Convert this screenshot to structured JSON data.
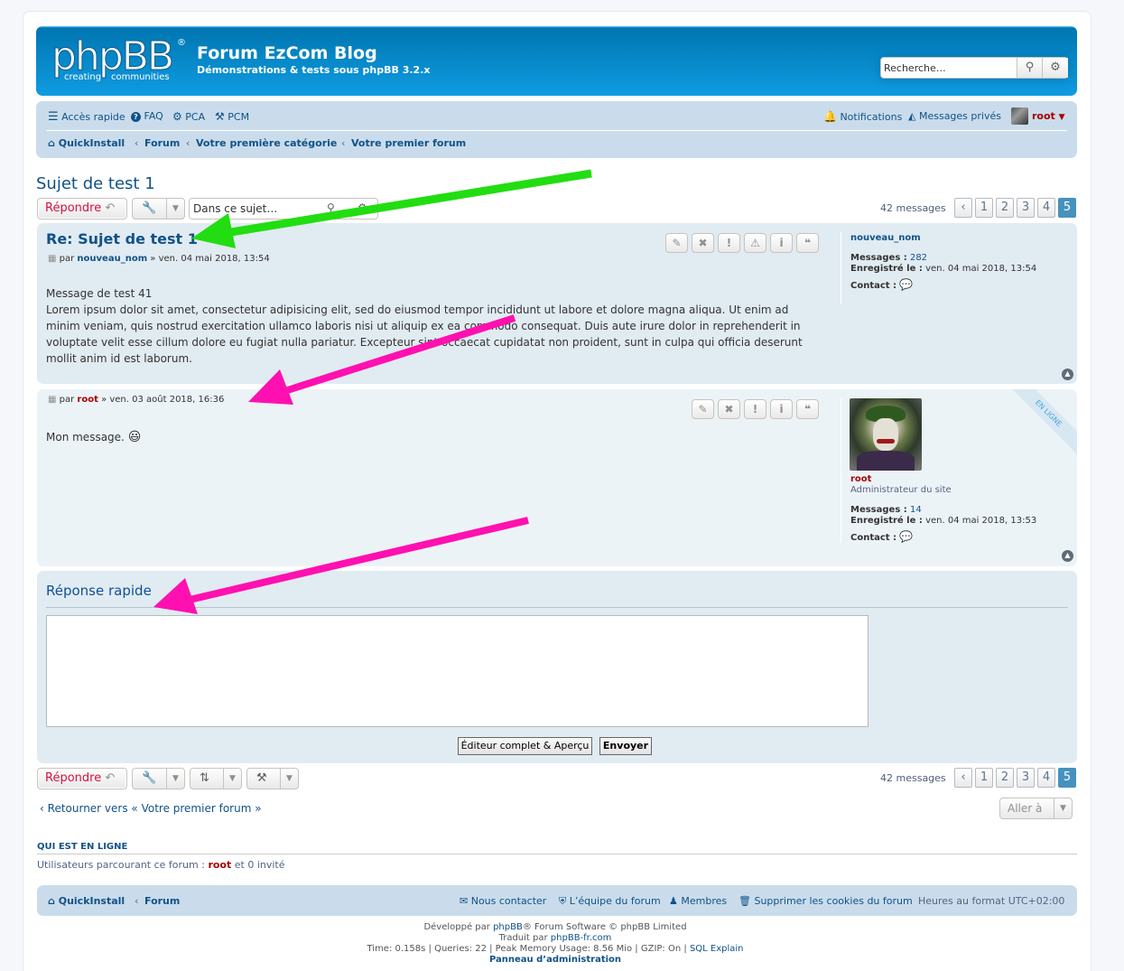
{
  "header": {
    "logo_text": "phpBB",
    "logo_reg": "®",
    "logo_tag1": "creating",
    "logo_tag2": "communities",
    "site_title": "Forum EzCom Blog",
    "site_description": "Démonstrations & tests sous phpBB 3.2.x",
    "search_placeholder": "Recherche…",
    "search_icon": "search-icon",
    "settings_icon": "gear-icon"
  },
  "nav": {
    "quick_access": "Accès rapide",
    "faq": "FAQ",
    "acp": "PCA",
    "mcp": "PCM",
    "notifications": "Notifications",
    "private_messages": "Messages privés",
    "username": "root"
  },
  "breadcrumbs": [
    "QuickInstall",
    "Forum",
    "Votre première catégorie",
    "Votre premier forum"
  ],
  "topic": {
    "title": "Sujet de test 1",
    "reply_label": "Répondre",
    "search_placeholder": "Dans ce sujet…",
    "message_count": "42 messages",
    "pages": [
      "1",
      "2",
      "3",
      "4",
      "5"
    ],
    "current_page": "5"
  },
  "posts": [
    {
      "title": "Re: Sujet de test 1",
      "by": "par",
      "author": "nouveau_nom",
      "date": "» ven. 04 mai 2018, 13:54",
      "content_line1": "Message de test 41",
      "content_body": "Lorem ipsum dolor sit amet, consectetur adipisicing elit, sed do eiusmod tempor incididunt ut labore et dolore magna aliqua. Ut enim ad minim veniam, quis nostrud exercitation ullamco laboris nisi ut aliquip ex ea commodo consequat. Duis aute irure dolor in reprehenderit in voluptate velit esse cillum dolore eu fugiat nulla pariatur. Excepteur sint occaecat cupidatat non proident, sunt in culpa qui officia deserunt mollit anim id est laborum.",
      "profile_name": "nouveau_nom",
      "messages_label": "Messages :",
      "messages_value": "282",
      "registered_label": "Enregistré le :",
      "registered_value": "ven. 04 mai 2018, 13:54",
      "contact_label": "Contact :"
    },
    {
      "by": "par",
      "author": "root",
      "date": "» ven. 03 août 2018, 16:36",
      "content": "Mon message.",
      "emoji": "😃",
      "online_ribbon": "EN LIGNE",
      "profile_name": "root",
      "profile_rank": "Administrateur du site",
      "messages_label": "Messages :",
      "messages_value": "14",
      "registered_label": "Enregistré le :",
      "registered_value": "ven. 04 mai 2018, 13:53",
      "contact_label": "Contact :"
    }
  ],
  "quick_reply": {
    "title": "Réponse rapide",
    "full_editor": "Éditeur complet & Aperçu",
    "submit": "Envoyer"
  },
  "bottom": {
    "return_link": "Retourner vers « Votre premier forum »",
    "jump_to": "Aller à",
    "online_title": "QUI EST EN LIGNE",
    "online_prefix": "Utilisateurs parcourant ce forum :",
    "online_user": "root",
    "online_suffix": "et 0 invité"
  },
  "footer": {
    "crumb1": "QuickInstall",
    "crumb2": "Forum",
    "contact": "Nous contacter",
    "team": "L’équipe du forum",
    "members": "Membres",
    "cookies": "Supprimer les cookies du forum",
    "timezone": "Heures au format UTC+02:00",
    "dev_prefix": "Développé par",
    "dev_link": "phpBB",
    "dev_suffix": "® Forum Software © phpBB Limited",
    "translated_prefix": "Traduit par",
    "translated_link": "phpBB-fr.com",
    "stats": "Time: 0.158s | Queries: 22 | Peak Memory Usage: 8.56 Mio | GZIP: On |",
    "sql_explain": "SQL Explain",
    "admin_panel": "Panneau d’administration"
  },
  "annotation_colors": {
    "green_arrow": "#22dd11",
    "pink_arrow": "#ff10b0"
  }
}
